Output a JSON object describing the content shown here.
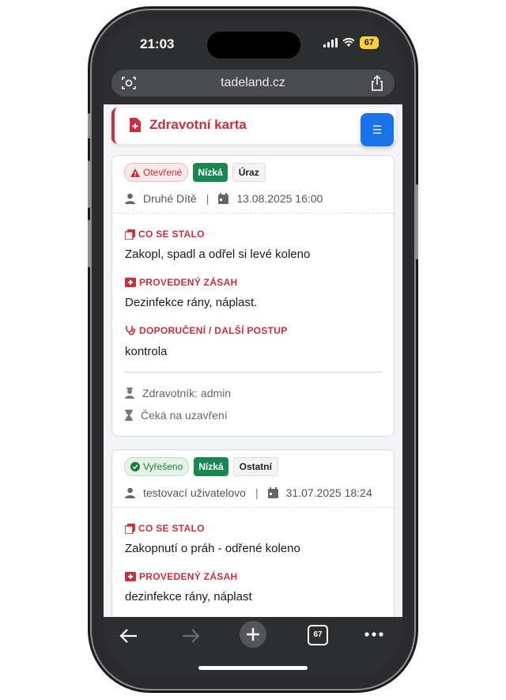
{
  "status_bar": {
    "time": "21:03",
    "battery": "67"
  },
  "browser": {
    "url": "tadeland.cz",
    "tab_count": "67"
  },
  "header": {
    "title": "Zdravotní karta"
  },
  "cards": [
    {
      "status": "Otevřené",
      "severity": "Nízká",
      "category": "Úraz",
      "person": "Druhé Dítě",
      "datetime": "13.08.2025 16:00",
      "what_label": "CO SE STALO",
      "what_text": "Zakopl, spadl a odřel si levé koleno",
      "action_label": "PROVEDENÝ ZÁSAH",
      "action_text": "Dezinfekce rány, náplast.",
      "reco_label": "DOPORUČENÍ / DALŠÍ POSTUP",
      "reco_text": "kontrola",
      "medic": "Zdravotník: admin",
      "state": "Čeká na uzavření"
    },
    {
      "status": "Vyřešeno",
      "severity": "Nízká",
      "category": "Ostatní",
      "person": "testovací uživatelovo",
      "datetime": "31.07.2025 18:24",
      "what_label": "CO SE STALO",
      "what_text": "Zakopnutí o práh - odřené koleno",
      "action_label": "PROVEDENÝ ZÁSAH",
      "action_text": "dezinfekce rány, náplast"
    }
  ],
  "colors": {
    "accent_red": "#c9303f",
    "menu_blue": "#1a73e8",
    "badge_green": "#198754"
  },
  "icons": [
    "lens-icon",
    "share-icon",
    "medical-file-icon",
    "menu-icon",
    "warning-icon",
    "check-circle-icon",
    "user-icon",
    "calendar-icon",
    "notes-icon",
    "first-aid-icon",
    "stethoscope-icon",
    "nurse-icon",
    "hourglass-icon",
    "back-arrow-icon",
    "forward-arrow-icon",
    "plus-icon",
    "more-icon"
  ]
}
